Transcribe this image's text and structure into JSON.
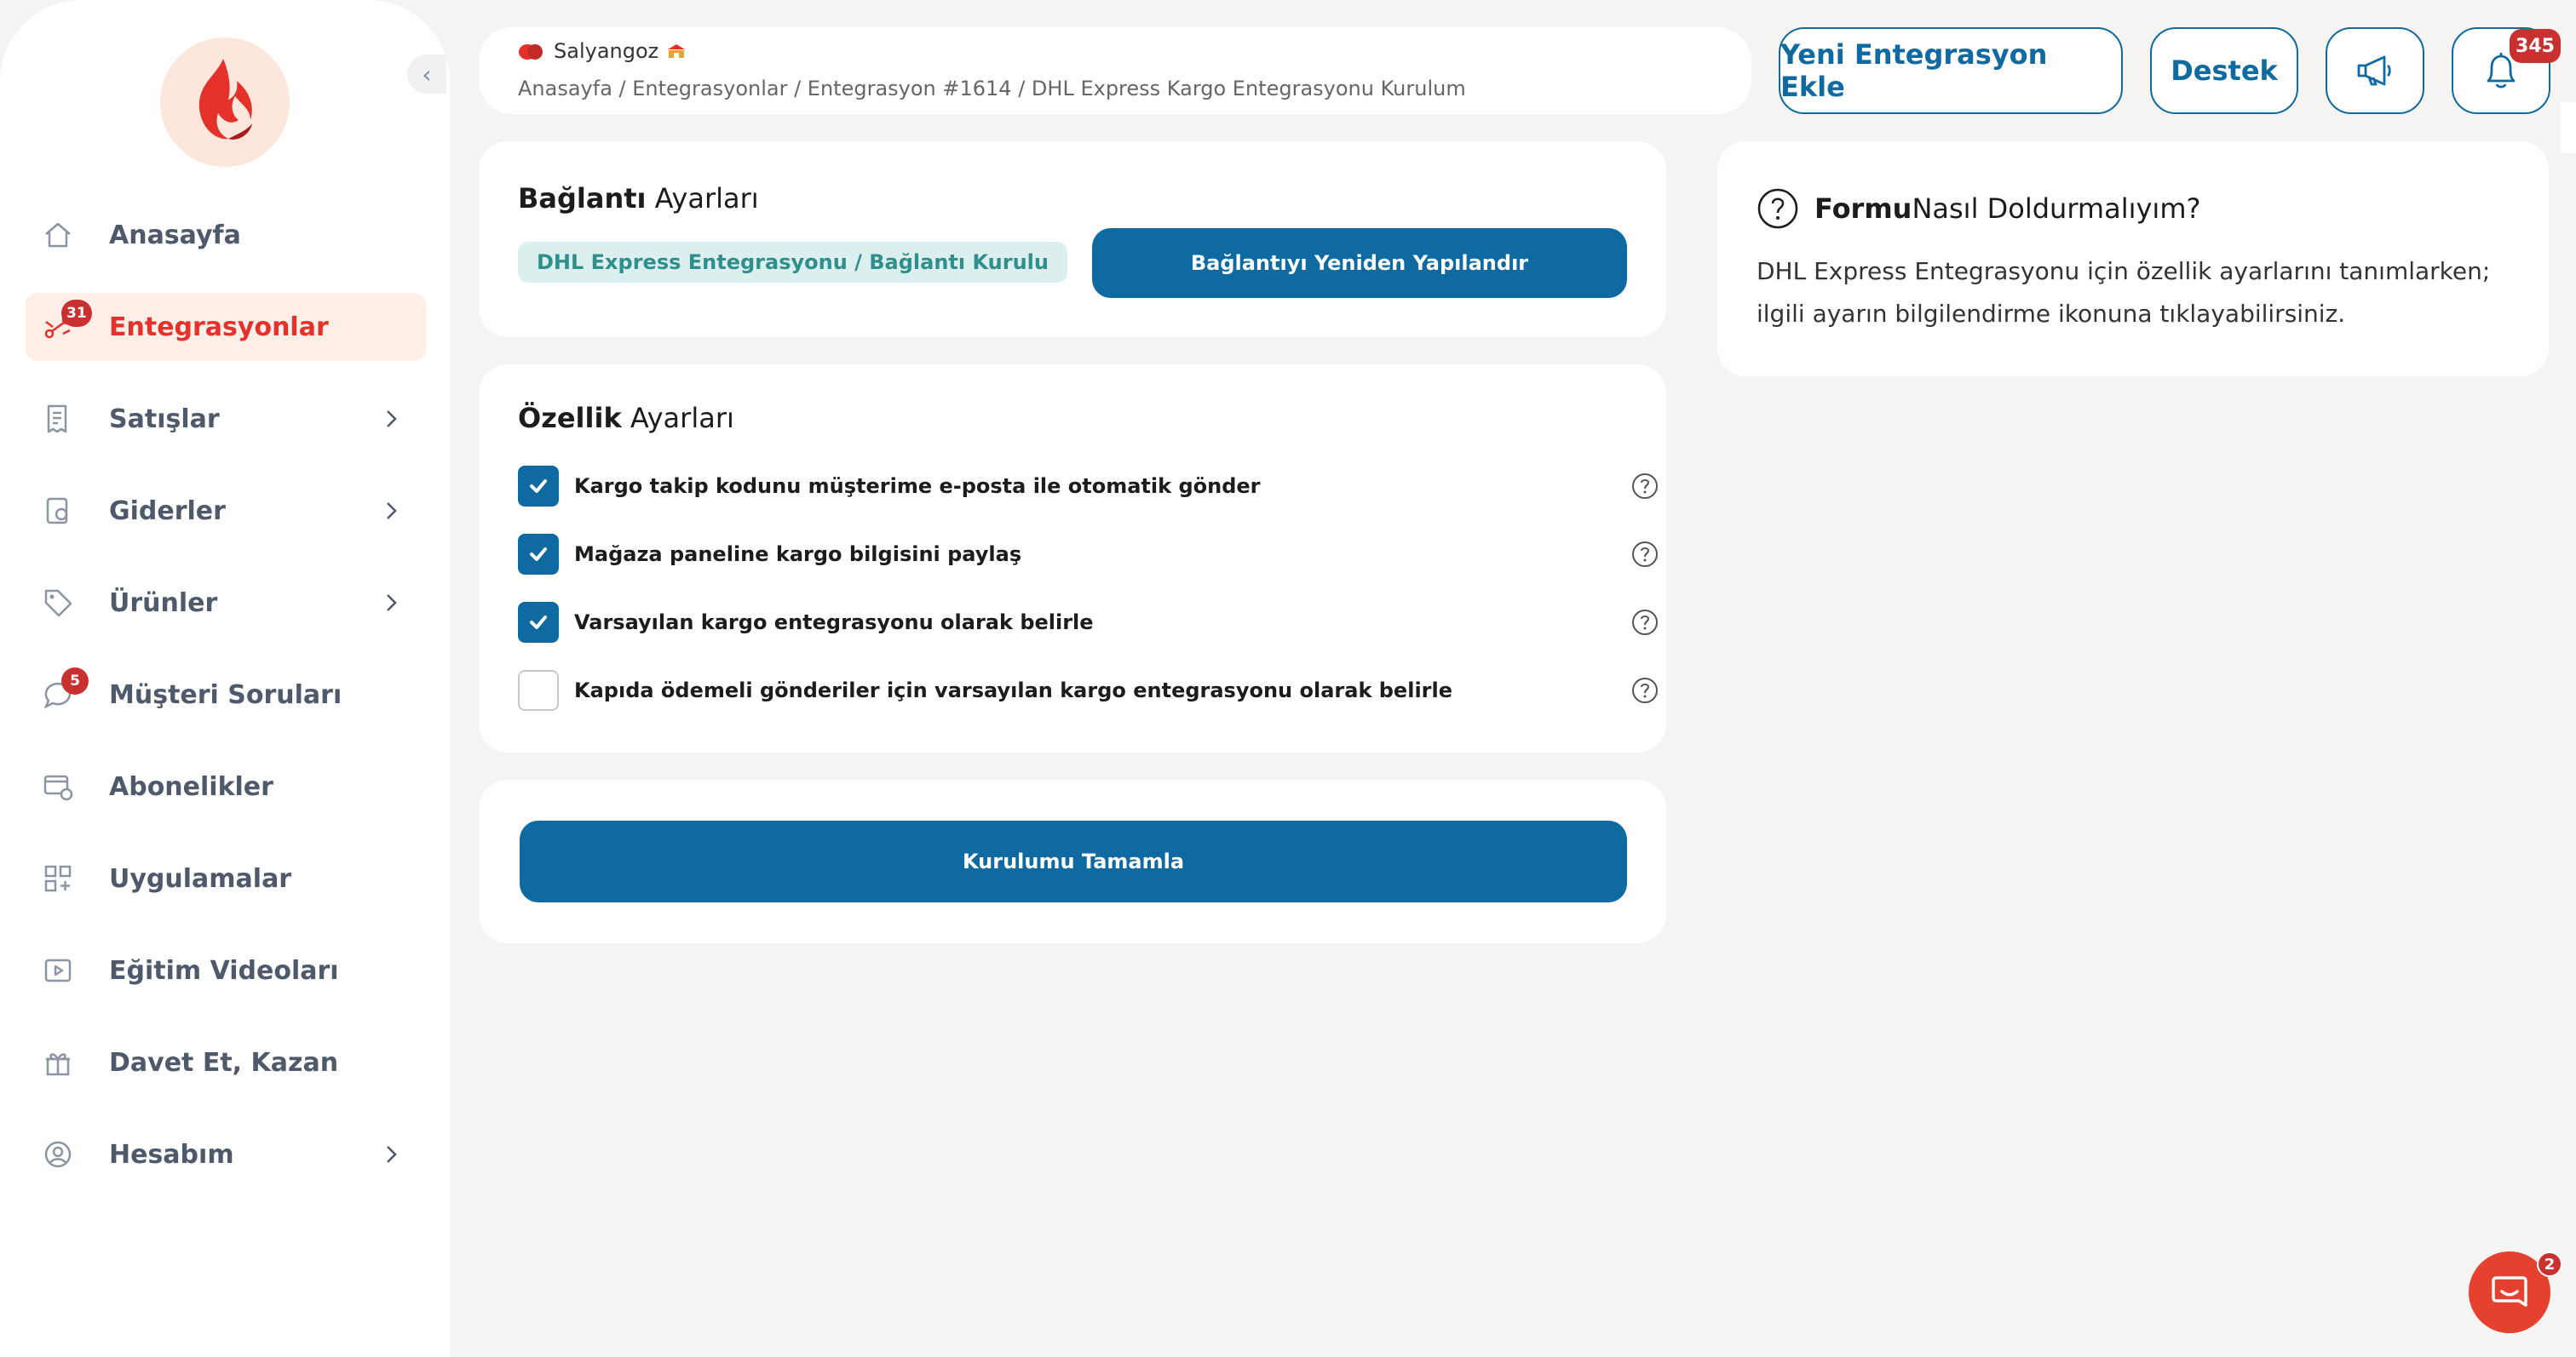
{
  "sidebar": {
    "items": [
      {
        "label": "Anasayfa",
        "icon": "home-icon"
      },
      {
        "label": "Entegrasyonlar",
        "icon": "integration-icon",
        "badge": "31",
        "active": true
      },
      {
        "label": "Satışlar",
        "icon": "receipt-icon"
      },
      {
        "label": "Giderler",
        "icon": "expense-icon"
      },
      {
        "label": "Ürünler",
        "icon": "tag-icon"
      },
      {
        "label": "Müşteri Soruları",
        "icon": "chat-question-icon",
        "badge": "5"
      },
      {
        "label": "Abonelikler",
        "icon": "subscription-icon"
      },
      {
        "label": "Uygulamalar",
        "icon": "apps-icon"
      },
      {
        "label": "Eğitim Videoları",
        "icon": "video-icon"
      },
      {
        "label": "Davet Et, Kazan",
        "icon": "gift-icon"
      },
      {
        "label": "Hesabım",
        "icon": "user-icon"
      }
    ]
  },
  "header": {
    "store_name": "Salyangoz",
    "breadcrumb": "Anasayfa / Entegrasyonlar / Entegrasyon #1614 / DHL Express Kargo Entegrasyonu Kurulum"
  },
  "actions": {
    "new_integration": "Yeni Entegrasyon Ekle",
    "support": "Destek",
    "notifications_count": "345"
  },
  "connection": {
    "title_bold": "Bağlantı",
    "title_rest": " Ayarları",
    "status": "DHL Express Entegrasyonu / Bağlantı Kurulu",
    "reconfigure_label": "Bağlantıyı Yeniden Yapılandır"
  },
  "features": {
    "title_bold": "Özellik",
    "title_rest": " Ayarları",
    "options": [
      {
        "label": "Kargo takip kodunu müşterime e-posta ile otomatik gönder",
        "checked": true
      },
      {
        "label": "Mağaza paneline kargo bilgisini paylaş",
        "checked": true
      },
      {
        "label": "Varsayılan kargo entegrasyonu olarak belirle",
        "checked": true
      },
      {
        "label": "Kapıda ödemeli gönderiler için varsayılan kargo entegrasyonu olarak belirle",
        "checked": false
      }
    ]
  },
  "complete": {
    "label": "Kurulumu Tamamla"
  },
  "help": {
    "title_bold": "Formu",
    "title_rest": " Nasıl Doldurmalıyım?",
    "text": "DHL Express Entegrasyonu için özellik ayarlarını tanımlarken; ilgili ayarın bilgilendirme ikonuna tıklayabilirsiniz."
  },
  "chat": {
    "badge": "2"
  },
  "colors": {
    "accent": "#0e6aa0",
    "brand_red": "#e4322a",
    "badge": "#c93030",
    "status_bg": "#dcefef"
  }
}
